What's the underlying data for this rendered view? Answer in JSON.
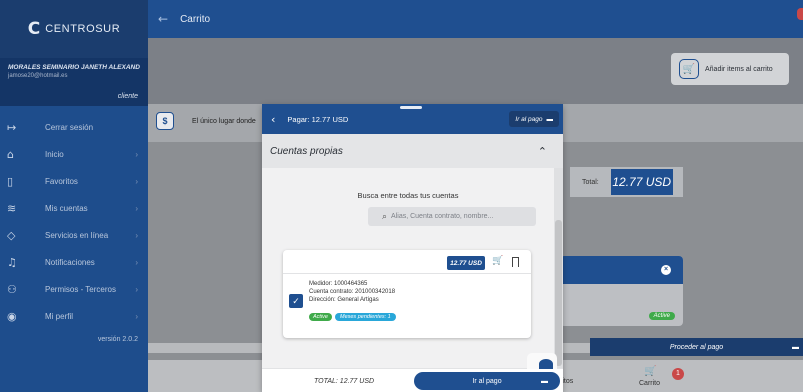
{
  "sidebar": {
    "brand_mark": "C",
    "brand_name": "CENTROSUR",
    "user_name": "MORALES SEMINARIO JANETH ALEXAND...",
    "user_email": "jamose20@hotmail.es",
    "user_role": "cliente",
    "items": [
      {
        "label": "Cerrar sesión",
        "icon": "logout-icon",
        "glyph": "↦"
      },
      {
        "label": "Inicio",
        "icon": "home-icon",
        "glyph": "⌂"
      },
      {
        "label": "Favoritos",
        "icon": "bookmark-icon",
        "glyph": "▯"
      },
      {
        "label": "Mis cuentas",
        "icon": "accounts-icon",
        "glyph": "≋"
      },
      {
        "label": "Servicios en línea",
        "icon": "services-icon",
        "glyph": "◇"
      },
      {
        "label": "Notificaciones",
        "icon": "bell-icon",
        "glyph": "♫"
      },
      {
        "label": "Permisos - Terceros",
        "icon": "users-icon",
        "glyph": "⚇"
      },
      {
        "label": "Mi perfil",
        "icon": "profile-icon",
        "glyph": "◉"
      }
    ],
    "version": "versión 2.0.2"
  },
  "header": {
    "back_glyph": "←",
    "title": "Carrito"
  },
  "main": {
    "add_items_label": "Añadir items al carrito",
    "unico_text": "El único lugar donde",
    "total_label": "Total:",
    "total_value": "12.77 USD",
    "card_status": "Active",
    "proceed_label": "Proceder al pago",
    "nav_item1": "ritos",
    "nav_item2": "Carrito",
    "cart_badge": "1"
  },
  "modal": {
    "title": "Pagar: 12.77 USD",
    "go_pay_label": "Ir al pago",
    "section_title": "Cuentas propias",
    "search_hint": "Busca entre todas tus cuentas",
    "search_placeholder": "Alias, Cuenta contrato, nombre...",
    "account": {
      "price": "12.77 USD",
      "medidor": "Medidor: 1000464365",
      "cuenta": "Cuenta contrato: 201000342018",
      "direccion": "Dirección: General Artigas",
      "status": "Active",
      "pending": "Meses pendientes: 1"
    },
    "footer_total": "TOTAL: 12.77 USD",
    "footer_pay": "Ir al pago"
  },
  "colors": {
    "brand_blue": "#1f4f90",
    "sidebar_blue": "#1e4d8c",
    "active_green": "#3faa4a",
    "pending_cyan": "#29a7d9",
    "alert_red": "#c94848"
  }
}
